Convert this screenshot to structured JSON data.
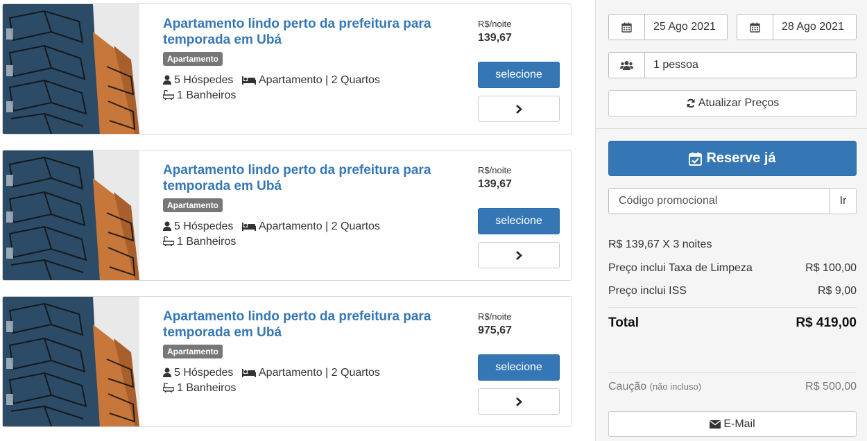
{
  "listings": [
    {
      "title": "Apartamento lindo perto da prefeitura para temporada em Ubá",
      "badge": "Apartamento",
      "guests": "5 Hóspedes",
      "type_rooms": "Apartamento | 2 Quartos",
      "bathrooms": "1 Banheiros",
      "price_label": "R$/noite",
      "price": "139,67",
      "select_label": "selecione"
    },
    {
      "title": "Apartamento lindo perto da prefeitura para temporada em Ubá",
      "badge": "Apartamento",
      "guests": "5 Hóspedes",
      "type_rooms": "Apartamento | 2 Quartos",
      "bathrooms": "1 Banheiros",
      "price_label": "R$/noite",
      "price": "139,67",
      "select_label": "selecione"
    },
    {
      "title": "Apartamento lindo perto da prefeitura para temporada em Ubá",
      "badge": "Apartamento",
      "guests": "5 Hóspedes",
      "type_rooms": "Apartamento | 2 Quartos",
      "bathrooms": "1 Banheiros",
      "price_label": "R$/noite",
      "price": "975,67",
      "select_label": "selecione"
    }
  ],
  "icons": {
    "listing_photo": "apartment-building-photo",
    "guests": "user-icon",
    "rooms": "bed-icon",
    "bath": "bath-icon",
    "more": "chevron-right-icon",
    "calendar": "calendar-icon",
    "people": "users-icon",
    "refresh": "refresh-icon",
    "reserve": "calendar-check-icon",
    "email": "envelope-icon"
  },
  "booking": {
    "checkin": "25 Ago 2021",
    "checkout": "28 Ago 2021",
    "guests": "1 pessoa",
    "update_label": "Atualizar Preços",
    "reserve_label": "Reserve já",
    "promo_placeholder": "Código promocional",
    "promo_go": "Ir",
    "nights_line": "R$ 139,67 X 3 noites",
    "cleaning_label": "Preço inclui Taxa de Limpeza",
    "cleaning_value": "R$ 100,00",
    "iss_label": "Preço inclui ISS",
    "iss_value": "R$ 9,00",
    "total_label": "Total",
    "total_value": "R$ 419,00",
    "deposit_label": "Caução",
    "deposit_note": "(não incluso)",
    "deposit_value": "R$ 500,00",
    "email_label": "E-Mail"
  },
  "colors": {
    "accent": "#3577b5",
    "badge": "#777777",
    "panel_bg": "#f5f5f5"
  }
}
